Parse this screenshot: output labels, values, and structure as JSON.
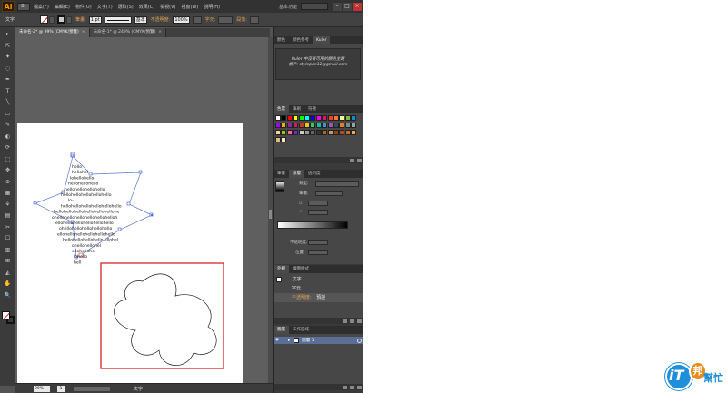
{
  "menubar": {
    "logo": "Ai",
    "bridge": "Br",
    "menus": [
      "檔案(F)",
      "編輯(E)",
      "物件(O)",
      "文字(T)",
      "選取(S)",
      "效果(C)",
      "檢視(V)",
      "視窗(W)",
      "說明(H)"
    ],
    "workspace": "基本功能",
    "minimize": "–",
    "maximize": "□",
    "close": "×"
  },
  "controlbar": {
    "tool_label": "文字",
    "stroke_label": "筆畫:",
    "stroke_value": "1 pt",
    "stroke_style": "基本",
    "opacity_label": "不透明度:",
    "opacity_value": "100%",
    "char_label": "字元:",
    "para_label": "段落:"
  },
  "doctabs": [
    {
      "label": "未命名-2* @ 99% (CMYK/預覽)",
      "close": "×"
    },
    {
      "label": "未命名-1* @ 249% (CMYK/預覽)",
      "close": "×"
    }
  ],
  "tools": [
    "▸",
    "⇱",
    "✦",
    "◌",
    "✒",
    "T",
    "╲",
    "▭",
    "✎",
    "◐",
    "⟳",
    "⬚",
    "✥",
    "⊕",
    "▦",
    "⚘",
    "▤",
    "✂",
    "☐",
    "▥",
    "⊞",
    "◭",
    "✋",
    "🔍"
  ],
  "artwork": {
    "text_lines": [
      "hello",
      "hellohel-",
      "lohellohello-",
      "hellohellohello",
      "hellohellohellohello",
      "hellohellohellohellohello",
      "lo-",
      "hellohellohellohellohellohello",
      "hellohellohellohellohellohellohe",
      "ohellohellohellohellohellohelloh",
      "ellohellohellohellohellohello",
      "ohellohellohellohellohello",
      "ellohellohellohellohellohello",
      "hellohellohellohello ellohel",
      "ohellohellohel",
      "ellohellohel",
      "lohello",
      "hell"
    ]
  },
  "statusbar": {
    "zoom": "99%",
    "page": "1",
    "tool": "文字"
  },
  "panels": {
    "kuler": {
      "tabs": [
        "顏色",
        "顏色參考",
        "Kuler"
      ],
      "active": "Kuler",
      "message_line1": "Kuler 中沒有可用的顏色主題",
      "message_line2": "帳戶: stylepan12@gmail.com"
    },
    "swatches": {
      "tabs": [
        "色票",
        "筆刷",
        "符號"
      ],
      "active": "色票",
      "colors": [
        "#ffffff",
        "#000000",
        "#ff0000",
        "#ffff00",
        "#00ff00",
        "#00ffff",
        "#0000ff",
        "#ff00ff",
        "#e01a4f",
        "#ee4035",
        "#f37736",
        "#fdf498",
        "#7bc043",
        "#0392cf",
        "#a200ff",
        "#f9a602",
        "#8e24aa",
        "#d81b60",
        "#c0392b",
        "#f1c40f",
        "#2ecc71",
        "#1abc9c",
        "#3498db",
        "#9b59b6",
        "#34495e",
        "#e67e22",
        "#7f8c8d",
        "#95a5a6",
        "#ffcc99",
        "#99cc00",
        "#ff6699",
        "#6633cc",
        "#cccccc",
        "#999999",
        "#666666",
        "#333333",
        "#b5651d",
        "#c19a6b",
        "#8b4513",
        "#a0522d",
        "#d2691e",
        "#f4a460",
        "#deb887",
        "#ffe4c4"
      ]
    },
    "gradient": {
      "tabs": [
        "筆畫",
        "漸層",
        "透明度"
      ],
      "active": "漸層",
      "type_label": "類型:",
      "stroke_label": "筆畫:",
      "angle_label": "△",
      "ratio_label": "⇔",
      "opacity_label": "不透明度:",
      "location_label": "位置:"
    },
    "appearance": {
      "tabs": [
        "外觀",
        "繪圖樣式"
      ],
      "active": "外觀",
      "rows": [
        {
          "label": "文字"
        },
        {
          "label": "字元"
        },
        {
          "label": "不透明度:",
          "value": "預設"
        }
      ]
    },
    "layers": {
      "tabs": [
        "圖層",
        "工作區域"
      ],
      "active": "圖層",
      "rows": [
        {
          "name": "圖層 1"
        }
      ]
    }
  },
  "logo": {
    "text_it": "iT",
    "text_bang": "邦",
    "text_help": "幫忙"
  }
}
